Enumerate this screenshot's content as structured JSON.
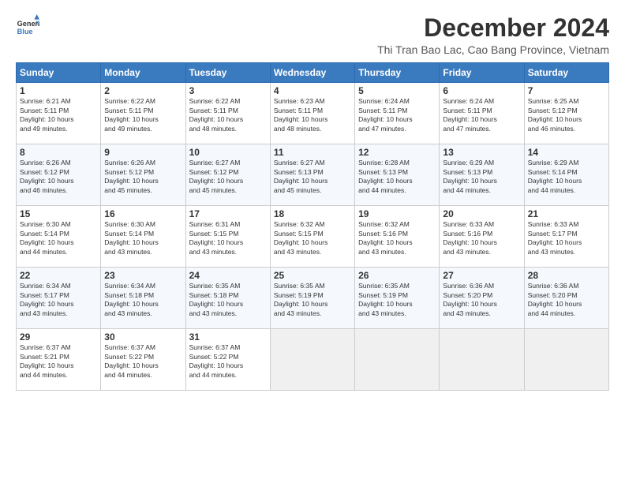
{
  "logo": {
    "line1": "General",
    "line2": "Blue"
  },
  "title": "December 2024",
  "subtitle": "Thi Tran Bao Lac, Cao Bang Province, Vietnam",
  "headers": [
    "Sunday",
    "Monday",
    "Tuesday",
    "Wednesday",
    "Thursday",
    "Friday",
    "Saturday"
  ],
  "weeks": [
    [
      {
        "day": "1",
        "info": "Sunrise: 6:21 AM\nSunset: 5:11 PM\nDaylight: 10 hours\nand 49 minutes."
      },
      {
        "day": "2",
        "info": "Sunrise: 6:22 AM\nSunset: 5:11 PM\nDaylight: 10 hours\nand 49 minutes."
      },
      {
        "day": "3",
        "info": "Sunrise: 6:22 AM\nSunset: 5:11 PM\nDaylight: 10 hours\nand 48 minutes."
      },
      {
        "day": "4",
        "info": "Sunrise: 6:23 AM\nSunset: 5:11 PM\nDaylight: 10 hours\nand 48 minutes."
      },
      {
        "day": "5",
        "info": "Sunrise: 6:24 AM\nSunset: 5:11 PM\nDaylight: 10 hours\nand 47 minutes."
      },
      {
        "day": "6",
        "info": "Sunrise: 6:24 AM\nSunset: 5:11 PM\nDaylight: 10 hours\nand 47 minutes."
      },
      {
        "day": "7",
        "info": "Sunrise: 6:25 AM\nSunset: 5:12 PM\nDaylight: 10 hours\nand 46 minutes."
      }
    ],
    [
      {
        "day": "8",
        "info": "Sunrise: 6:26 AM\nSunset: 5:12 PM\nDaylight: 10 hours\nand 46 minutes."
      },
      {
        "day": "9",
        "info": "Sunrise: 6:26 AM\nSunset: 5:12 PM\nDaylight: 10 hours\nand 45 minutes."
      },
      {
        "day": "10",
        "info": "Sunrise: 6:27 AM\nSunset: 5:12 PM\nDaylight: 10 hours\nand 45 minutes."
      },
      {
        "day": "11",
        "info": "Sunrise: 6:27 AM\nSunset: 5:13 PM\nDaylight: 10 hours\nand 45 minutes."
      },
      {
        "day": "12",
        "info": "Sunrise: 6:28 AM\nSunset: 5:13 PM\nDaylight: 10 hours\nand 44 minutes."
      },
      {
        "day": "13",
        "info": "Sunrise: 6:29 AM\nSunset: 5:13 PM\nDaylight: 10 hours\nand 44 minutes."
      },
      {
        "day": "14",
        "info": "Sunrise: 6:29 AM\nSunset: 5:14 PM\nDaylight: 10 hours\nand 44 minutes."
      }
    ],
    [
      {
        "day": "15",
        "info": "Sunrise: 6:30 AM\nSunset: 5:14 PM\nDaylight: 10 hours\nand 44 minutes."
      },
      {
        "day": "16",
        "info": "Sunrise: 6:30 AM\nSunset: 5:14 PM\nDaylight: 10 hours\nand 43 minutes."
      },
      {
        "day": "17",
        "info": "Sunrise: 6:31 AM\nSunset: 5:15 PM\nDaylight: 10 hours\nand 43 minutes."
      },
      {
        "day": "18",
        "info": "Sunrise: 6:32 AM\nSunset: 5:15 PM\nDaylight: 10 hours\nand 43 minutes."
      },
      {
        "day": "19",
        "info": "Sunrise: 6:32 AM\nSunset: 5:16 PM\nDaylight: 10 hours\nand 43 minutes."
      },
      {
        "day": "20",
        "info": "Sunrise: 6:33 AM\nSunset: 5:16 PM\nDaylight: 10 hours\nand 43 minutes."
      },
      {
        "day": "21",
        "info": "Sunrise: 6:33 AM\nSunset: 5:17 PM\nDaylight: 10 hours\nand 43 minutes."
      }
    ],
    [
      {
        "day": "22",
        "info": "Sunrise: 6:34 AM\nSunset: 5:17 PM\nDaylight: 10 hours\nand 43 minutes."
      },
      {
        "day": "23",
        "info": "Sunrise: 6:34 AM\nSunset: 5:18 PM\nDaylight: 10 hours\nand 43 minutes."
      },
      {
        "day": "24",
        "info": "Sunrise: 6:35 AM\nSunset: 5:18 PM\nDaylight: 10 hours\nand 43 minutes."
      },
      {
        "day": "25",
        "info": "Sunrise: 6:35 AM\nSunset: 5:19 PM\nDaylight: 10 hours\nand 43 minutes."
      },
      {
        "day": "26",
        "info": "Sunrise: 6:35 AM\nSunset: 5:19 PM\nDaylight: 10 hours\nand 43 minutes."
      },
      {
        "day": "27",
        "info": "Sunrise: 6:36 AM\nSunset: 5:20 PM\nDaylight: 10 hours\nand 43 minutes."
      },
      {
        "day": "28",
        "info": "Sunrise: 6:36 AM\nSunset: 5:20 PM\nDaylight: 10 hours\nand 44 minutes."
      }
    ],
    [
      {
        "day": "29",
        "info": "Sunrise: 6:37 AM\nSunset: 5:21 PM\nDaylight: 10 hours\nand 44 minutes."
      },
      {
        "day": "30",
        "info": "Sunrise: 6:37 AM\nSunset: 5:22 PM\nDaylight: 10 hours\nand 44 minutes."
      },
      {
        "day": "31",
        "info": "Sunrise: 6:37 AM\nSunset: 5:22 PM\nDaylight: 10 hours\nand 44 minutes."
      },
      null,
      null,
      null,
      null
    ]
  ]
}
